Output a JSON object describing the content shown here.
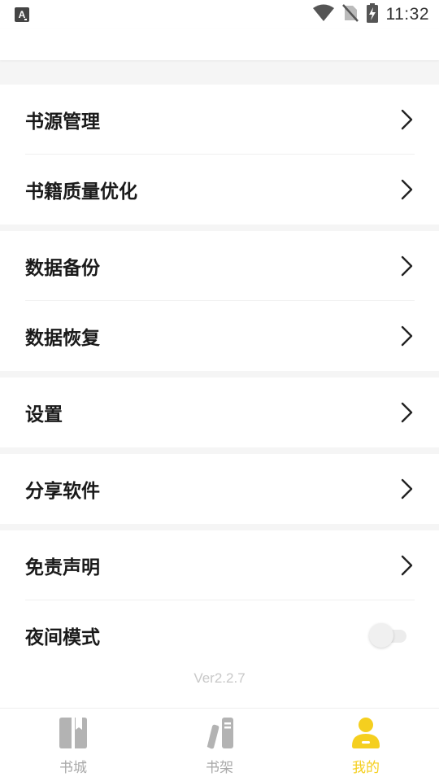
{
  "status_bar": {
    "time": "11:32",
    "left_icon": "a-notification-icon"
  },
  "menu": {
    "groups": [
      {
        "items": [
          {
            "label": "书源管理"
          },
          {
            "label": "书籍质量优化"
          }
        ]
      },
      {
        "items": [
          {
            "label": "数据备份"
          },
          {
            "label": "数据恢复"
          }
        ]
      },
      {
        "items": [
          {
            "label": "设置"
          }
        ]
      },
      {
        "items": [
          {
            "label": "分享软件"
          }
        ]
      },
      {
        "items": [
          {
            "label": "免责声明"
          },
          {
            "label": "夜间模式",
            "toggle": false
          }
        ]
      }
    ]
  },
  "version": "Ver2.2.7",
  "tabs": [
    {
      "label": "书城",
      "icon": "book-icon",
      "active": false
    },
    {
      "label": "书架",
      "icon": "bookshelf-icon",
      "active": false
    },
    {
      "label": "我的",
      "icon": "profile-icon",
      "active": true
    }
  ],
  "colors": {
    "accent": "#f5cf1f",
    "inactive": "#a9a9a9"
  }
}
